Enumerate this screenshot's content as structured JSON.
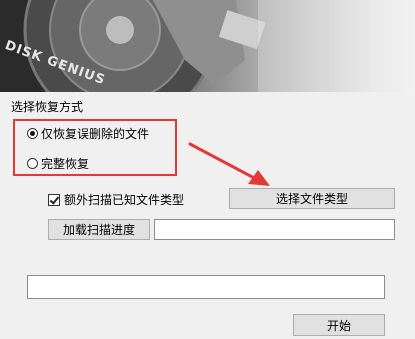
{
  "banner": {
    "brand_text": "DISK GENIUS"
  },
  "recovery_mode": {
    "title": "选择恢复方式",
    "options": [
      {
        "label": "仅恢复误删除的文件",
        "selected": true
      },
      {
        "label": "完整恢复",
        "selected": false
      }
    ]
  },
  "extra_scan": {
    "label": "额外扫描已知文件类型",
    "checked": true
  },
  "buttons": {
    "select_file_types": "选择文件类型",
    "load_progress": "加载扫描进度",
    "start": "开始"
  },
  "fields": {
    "progress_path_value": "",
    "output_value": ""
  },
  "colors": {
    "highlight_border": "#e53935",
    "annotation_arrow": "#e53935"
  }
}
